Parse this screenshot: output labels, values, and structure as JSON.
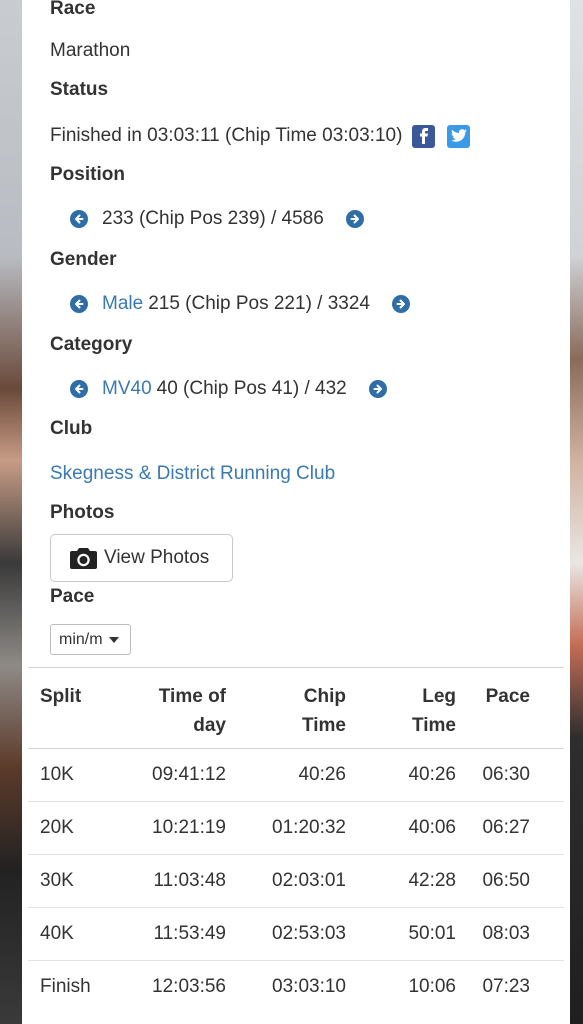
{
  "race": {
    "label": "Race",
    "value": "Marathon"
  },
  "status": {
    "label": "Status",
    "value": "Finished in 03:03:11 (Chip Time 03:03:10)",
    "icons": [
      "facebook-icon",
      "twitter-icon"
    ]
  },
  "position": {
    "label": "Position",
    "value": "233 (Chip Pos 239) / 4586"
  },
  "gender": {
    "label": "Gender",
    "link": "Male",
    "value": "215 (Chip Pos 221) / 3324"
  },
  "category": {
    "label": "Category",
    "link": "MV40",
    "value": "40 (Chip Pos 41) / 432"
  },
  "club": {
    "label": "Club",
    "value": "Skegness & District Running Club"
  },
  "photos": {
    "label": "Photos",
    "button": "View Photos"
  },
  "pace": {
    "label": "Pace",
    "selected": "min/m"
  },
  "splits": {
    "headers": {
      "split": "Split",
      "tod_1": "Time of",
      "tod_2": "day",
      "chip_1": "Chip",
      "chip_2": "Time",
      "leg_1": "Leg",
      "leg_2": "Time",
      "pace": "Pace"
    },
    "rows": [
      {
        "split": "10K",
        "tod": "09:41:12",
        "chip": "40:26",
        "leg": "40:26",
        "pace": "06:30"
      },
      {
        "split": "20K",
        "tod": "10:21:19",
        "chip": "01:20:32",
        "leg": "40:06",
        "pace": "06:27"
      },
      {
        "split": "30K",
        "tod": "11:03:48",
        "chip": "02:03:01",
        "leg": "42:28",
        "pace": "06:50"
      },
      {
        "split": "40K",
        "tod": "11:53:49",
        "chip": "02:53:03",
        "leg": "50:01",
        "pace": "08:03"
      },
      {
        "split": "Finish",
        "tod": "12:03:56",
        "chip": "03:03:10",
        "leg": "10:06",
        "pace": "07:23"
      }
    ]
  },
  "colors": {
    "link": "#3a7ab0",
    "nav_icon": "#2f6da6",
    "facebook": "#3b5998",
    "twitter": "#3a9ae8"
  }
}
